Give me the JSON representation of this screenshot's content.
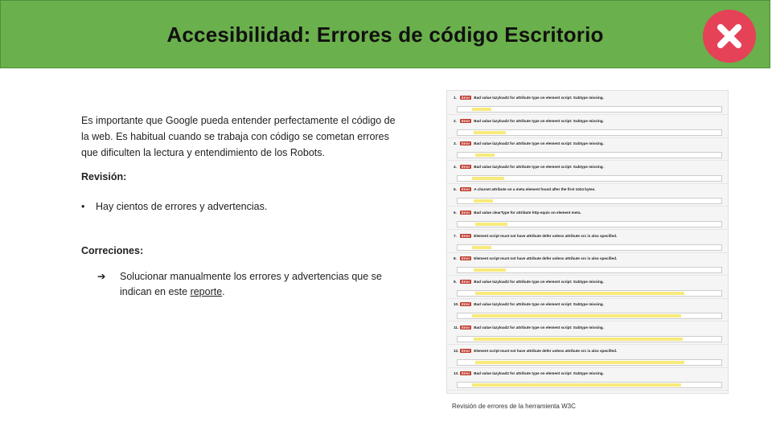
{
  "header": {
    "title": "Accesibilidad: Errores de código Escritorio",
    "status_icon": "close-icon",
    "status_color": "#e54257",
    "bar_color": "#6ab04c"
  },
  "content": {
    "intro": "Es importante que Google pueda entender perfectamente el código de la web. Es habitual cuando se trabaja con código se cometan errores que dificulten la lectura y entendimiento de los Robots.",
    "revision_heading": "Revisión:",
    "revision_bullet": "Hay cientos de errores y advertencias.",
    "corrections_heading": "Correciones:",
    "corrections_item_before": "Solucionar manualmente los errores y advertencias que se indican en este ",
    "corrections_link": "reporte",
    "corrections_item_after": "."
  },
  "screenshot": {
    "caption": "Revisión de errores de la herramienta W3C",
    "error_label": "Error",
    "entries": [
      {
        "n": "1.",
        "msg": "Bad value lazyload2 for attribute type on element script: Subtype missing."
      },
      {
        "n": "2.",
        "msg": "Bad value lazyload2 for attribute type on element script: Subtype missing."
      },
      {
        "n": "3.",
        "msg": "Bad value lazyload2 for attribute type on element script: Subtype missing."
      },
      {
        "n": "4.",
        "msg": "Bad value lazyload2 for attribute type on element script: Subtype missing."
      },
      {
        "n": "5.",
        "msg": "A charset attribute on a meta element found after the first 1024 bytes."
      },
      {
        "n": "6.",
        "msg": "Bad value clearType for attribute http-equiv on element meta."
      },
      {
        "n": "7.",
        "msg": "Element script must not have attribute defer unless attribute src is also specified."
      },
      {
        "n": "8.",
        "msg": "Element script must not have attribute defer unless attribute src is also specified."
      },
      {
        "n": "9.",
        "msg": "Bad value lazyload2 for attribute type on element script: Subtype missing."
      },
      {
        "n": "10.",
        "msg": "Bad value lazyload2 for attribute type on element script: Subtype missing."
      },
      {
        "n": "11.",
        "msg": "Bad value lazyload2 for attribute type on element script: Subtype missing."
      },
      {
        "n": "12.",
        "msg": "Element script must not have attribute defer unless attribute src is also specified."
      },
      {
        "n": "13.",
        "msg": "Bad value lazyload2 for attribute type on element script: Subtype missing."
      }
    ]
  }
}
